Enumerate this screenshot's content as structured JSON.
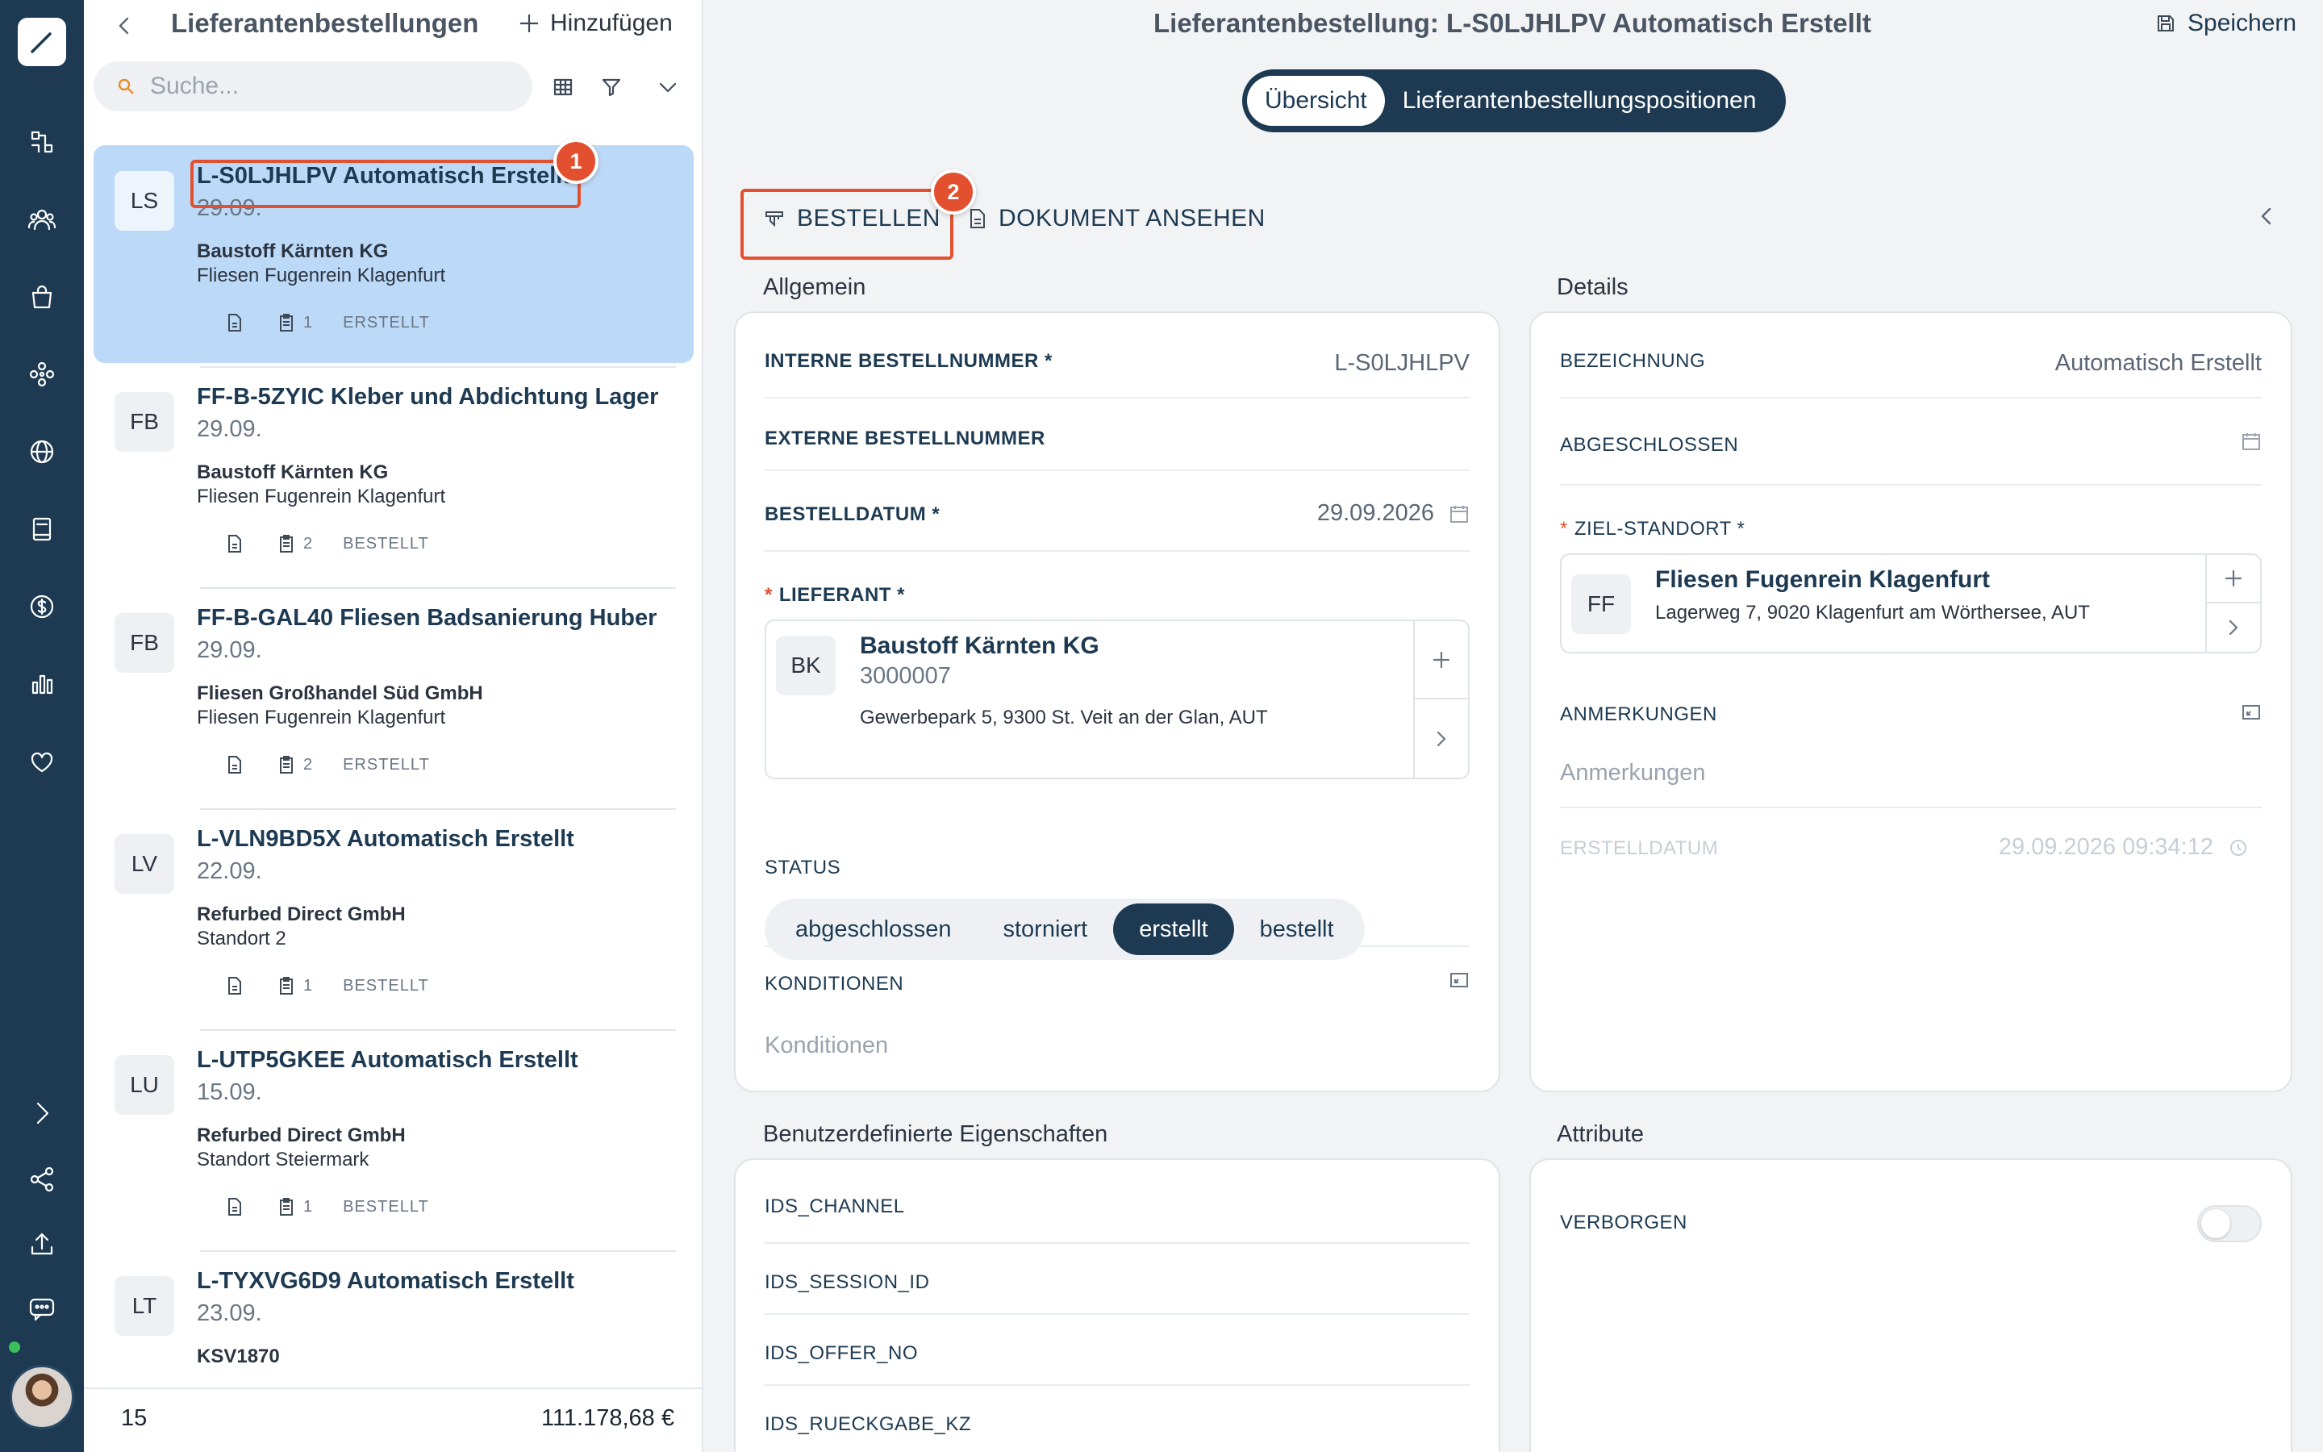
{
  "list": {
    "title": "Lieferantenbestellungen",
    "add_label": "Hinzufügen",
    "search_placeholder": "Suche...",
    "total_count": "15",
    "total_sum": "111.178,68 €",
    "orders": [
      {
        "initials": "LS",
        "title": "L-S0LJHLPV Automatisch Erstellt",
        "date": "29.09.",
        "supplier": "Baustoff Kärnten KG",
        "location": "Fliesen Fugenrein Klagenfurt",
        "count": "1",
        "status": "ERSTELLT"
      },
      {
        "initials": "FB",
        "title": "FF-B-5ZYIC Kleber und Abdichtung Lager",
        "date": "29.09.",
        "supplier": "Baustoff Kärnten KG",
        "location": "Fliesen Fugenrein Klagenfurt",
        "count": "2",
        "status": "BESTELLT"
      },
      {
        "initials": "FB",
        "title": "FF-B-GAL40 Fliesen Badsanierung Huber",
        "date": "29.09.",
        "supplier": "Fliesen Großhandel Süd GmbH",
        "location": "Fliesen Fugenrein Klagenfurt",
        "count": "2",
        "status": "ERSTELLT"
      },
      {
        "initials": "LV",
        "title": "L-VLN9BD5X Automatisch Erstellt",
        "date": "22.09.",
        "supplier": "Refurbed Direct GmbH",
        "location": "Standort 2",
        "count": "1",
        "status": "BESTELLT"
      },
      {
        "initials": "LU",
        "title": "L-UTP5GKEE Automatisch Erstellt",
        "date": "15.09.",
        "supplier": "Refurbed Direct GmbH",
        "location": "Standort Steiermark",
        "count": "1",
        "status": "BESTELLT"
      },
      {
        "initials": "LT",
        "title": "L-TYXVG6D9 Automatisch Erstellt",
        "date": "23.09.",
        "supplier": "KSV1870",
        "location": "",
        "count": "",
        "status": ""
      }
    ]
  },
  "main": {
    "title": "Lieferantenbestellung: L-S0LJHLPV Automatisch Erstellt",
    "save_label": "Speichern",
    "tabs": [
      "Übersicht",
      "Lieferantenbestellungspositionen"
    ],
    "actions": {
      "order": "BESTELLEN",
      "view_document": "DOKUMENT ANSEHEN"
    },
    "markers": [
      "1",
      "2"
    ],
    "general": {
      "section_title": "Allgemein",
      "internal_no_label": "INTERNE BESTELLNUMMER *",
      "internal_no_value": "L-S0LJHLPV",
      "external_no_label": "EXTERNE BESTELLNUMMER",
      "order_date_label": "BESTELLDATUM *",
      "order_date_value": "29.09.2026",
      "supplier_label": "LIEFERANT *",
      "supplier": {
        "initials": "BK",
        "name": "Baustoff Kärnten KG",
        "number": "3000007",
        "address": "Gewerbepark 5, 9300 St. Veit an der Glan, AUT"
      },
      "status_label": "STATUS",
      "status_options": [
        "abgeschlossen",
        "storniert",
        "erstellt",
        "bestellt"
      ],
      "status_selected": "erstellt",
      "conditions_label": "KONDITIONEN",
      "conditions_placeholder": "Konditionen"
    },
    "details": {
      "section_title": "Details",
      "name_label": "BEZEICHNUNG",
      "name_value": "Automatisch Erstellt",
      "closed_label": "ABGESCHLOSSEN",
      "target_label": "ZIEL-STANDORT *",
      "target": {
        "initials": "FF",
        "name": "Fliesen Fugenrein Klagenfurt",
        "address": "Lagerweg 7, 9020 Klagenfurt am Wörthersee, AUT"
      },
      "notes_label": "ANMERKUNGEN",
      "notes_placeholder": "Anmerkungen",
      "created_label": "ERSTELLDATUM",
      "created_value": "29.09.2026 09:34:12"
    },
    "custom_props": {
      "section_title": "Benutzerdefinierte Eigenschaften",
      "fields": [
        "IDS_CHANNEL",
        "IDS_SESSION_ID",
        "IDS_OFFER_NO",
        "IDS_RUECKGABE_KZ"
      ]
    },
    "attributes": {
      "section_title": "Attribute",
      "hidden_label": "VERBORGEN",
      "hidden_on": false
    }
  }
}
